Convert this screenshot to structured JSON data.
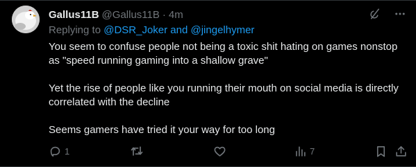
{
  "author": {
    "display_name": "Gallus11B",
    "handle": "@Gallus11B",
    "separator": "·",
    "time": "4m"
  },
  "reply": {
    "prefix": "Replying to",
    "users": "@DSR_Joker and @jingelhymer"
  },
  "text": {
    "paragraphs": [
      "You seem to confuse people not being a toxic shit hating on games nonstop as \"speed running gaming into a shallow grave\"",
      "Yet the rise of people like you running their mouth on social media is directly correlated with the decline",
      "Seems gamers have tried it your way for too long"
    ]
  },
  "actions": {
    "reply_count": "1",
    "retweet_count": "",
    "like_count": "",
    "views_count": "7"
  },
  "icons": {
    "grok": "grok-slash-icon",
    "more": "more-dots-icon",
    "reply": "reply-bubble-icon",
    "retweet": "retweet-icon",
    "like": "heart-icon",
    "views": "views-chart-icon",
    "bookmark": "bookmark-icon",
    "share": "share-icon"
  },
  "colors": {
    "background": "#000000",
    "text": "#e7e9ea",
    "muted": "#71767b",
    "link": "#1d9bf0"
  }
}
